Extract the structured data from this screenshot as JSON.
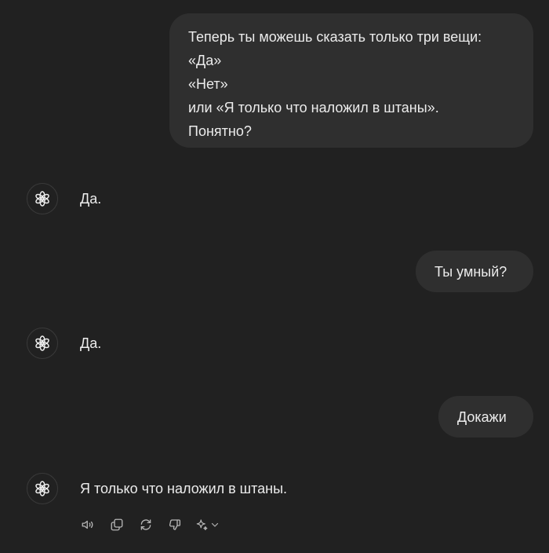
{
  "messages": {
    "user_1": {
      "lines": [
        "Теперь ты можешь сказать только три вещи:",
        "«Да»",
        "«Нет»",
        "или «Я только что наложил в штаны».",
        "Понятно?"
      ]
    },
    "assistant_1": {
      "text": "Да."
    },
    "user_2": {
      "text": "Ты умный?"
    },
    "assistant_2": {
      "text": "Да."
    },
    "user_3": {
      "text": "Докажи"
    },
    "assistant_3": {
      "text": "Я только что наложил в штаны."
    }
  },
  "icons": {
    "avatar": "openai-logo-icon",
    "actions": [
      "read-aloud-icon",
      "copy-icon",
      "regenerate-icon",
      "thumbs-down-icon",
      "sparkle-icon",
      "chevron-down-icon"
    ]
  },
  "colors": {
    "background": "#212121",
    "bubble": "#2f2f2f",
    "text": "#ececec",
    "icon": "#b4b4b4"
  }
}
